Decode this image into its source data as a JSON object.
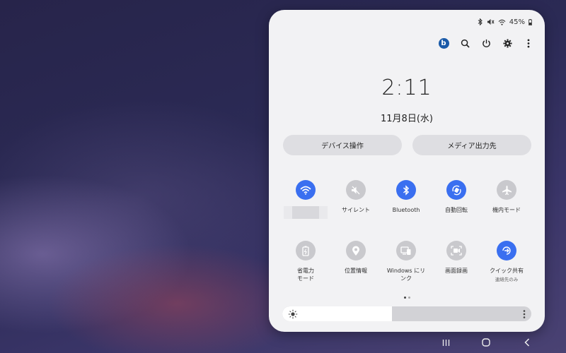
{
  "status_bar": {
    "battery": "45%",
    "icons": [
      "bluetooth-icon",
      "mute-icon",
      "wifi-icon",
      "battery-icon"
    ]
  },
  "toolbar": {
    "profile_initial": "b",
    "icons": [
      "search-icon",
      "power-icon",
      "gear-icon",
      "more-vertical-icon"
    ]
  },
  "clock": {
    "time": "2:11",
    "date": "11月8日(水)"
  },
  "buttons": {
    "device_control": "デバイス操作",
    "media_output": "メディア出力先"
  },
  "tiles": [
    {
      "label": "",
      "icon": "wifi-icon",
      "state": "on"
    },
    {
      "label": "サイレント",
      "icon": "mute-icon",
      "state": "off"
    },
    {
      "label": "Bluetooth",
      "icon": "bluetooth-icon",
      "state": "on"
    },
    {
      "label": "自動回転",
      "icon": "auto-rotate-icon",
      "state": "on"
    },
    {
      "label": "機内モード",
      "icon": "airplane-icon",
      "state": "off"
    },
    {
      "label": "省電力\nモード",
      "icon": "power-saving-icon",
      "state": "off"
    },
    {
      "label": "位置情報",
      "icon": "location-icon",
      "state": "off"
    },
    {
      "label": "Windows にリ\nンク",
      "icon": "link-to-windows-icon",
      "state": "off"
    },
    {
      "label": "画面録画",
      "icon": "screen-recorder-icon",
      "state": "off"
    },
    {
      "label": "クイック共有",
      "sublabel": "連絡先のみ",
      "icon": "quick-share-icon",
      "state": "on"
    }
  ],
  "pagination": {
    "pages": 2,
    "current": 1
  },
  "brightness": {
    "level": 0.44
  },
  "colors": {
    "accent": "#3a6ff0",
    "tile_off": "#c9c9cd",
    "panel": "#f2f2f4"
  }
}
